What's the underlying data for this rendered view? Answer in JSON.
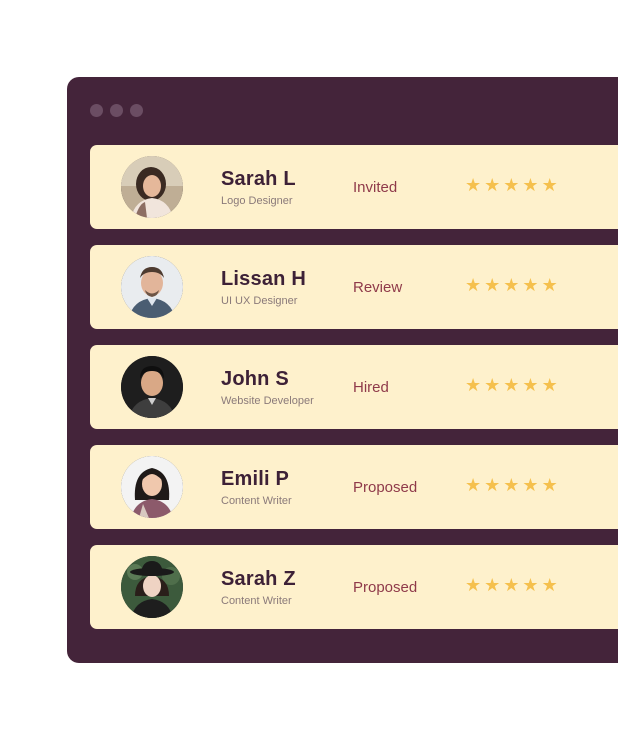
{
  "window": {
    "controls": [
      "dot",
      "dot",
      "dot"
    ]
  },
  "colors": {
    "window_bg": "#44243a",
    "row_bg": "#fef1cc",
    "name": "#3d2137",
    "status": "#8f3a4a",
    "star": "#f5c04d"
  },
  "rows": [
    {
      "name": "Sarah L",
      "role": "Logo Designer",
      "status": "Invited",
      "rating": 5,
      "avatar_icon": "woman-portrait-avatar"
    },
    {
      "name": "Lissan H",
      "role": "UI UX Designer",
      "status": "Review",
      "rating": 5,
      "avatar_icon": "man-portrait-avatar"
    },
    {
      "name": "John S",
      "role": "Website Developer",
      "status": "Hired",
      "rating": 5,
      "avatar_icon": "man-portrait-avatar"
    },
    {
      "name": "Emili P",
      "role": "Content Writer",
      "status": "Proposed",
      "rating": 5,
      "avatar_icon": "woman-portrait-avatar"
    },
    {
      "name": "Sarah Z",
      "role": "Content Writer",
      "status": "Proposed",
      "rating": 5,
      "avatar_icon": "woman-hat-portrait-avatar"
    }
  ]
}
